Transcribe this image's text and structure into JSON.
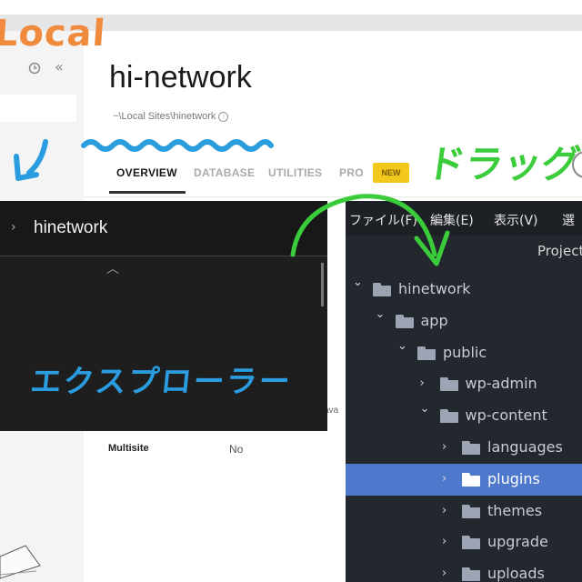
{
  "local_app": {
    "site_title": "hi-network",
    "site_path": "~\\Local Sites\\hinetwork",
    "tabs": [
      {
        "label": "OVERVIEW",
        "active": true
      },
      {
        "label": "DATABASE",
        "active": false
      },
      {
        "label": "UTILITIES",
        "active": false
      },
      {
        "label": "PRO",
        "active": false
      }
    ],
    "pro_badge": "NEW",
    "truncated_text": "ava",
    "multisite_label": "Multisite",
    "multisite_value": "No",
    "icons": [
      "clock-icon",
      "collapse-sidebar-icon",
      "info-icon"
    ]
  },
  "explorer": {
    "folder_title": "hinetwork",
    "icons": [
      "chevron-right-icon",
      "chevron-up-icon"
    ]
  },
  "editor": {
    "menu": [
      "ファイル(F)",
      "編集(E)",
      "表示(V)",
      "選"
    ],
    "project_title": "Project",
    "tree": [
      {
        "label": "hinetwork",
        "depth": 0,
        "expanded": true,
        "selected": false
      },
      {
        "label": "app",
        "depth": 1,
        "expanded": true,
        "selected": false
      },
      {
        "label": "public",
        "depth": 2,
        "expanded": true,
        "selected": false
      },
      {
        "label": "wp-admin",
        "depth": 3,
        "expanded": false,
        "selected": false
      },
      {
        "label": "wp-content",
        "depth": 3,
        "expanded": true,
        "selected": false
      },
      {
        "label": "languages",
        "depth": 4,
        "expanded": false,
        "selected": false
      },
      {
        "label": "plugins",
        "depth": 4,
        "expanded": false,
        "selected": true
      },
      {
        "label": "themes",
        "depth": 4,
        "expanded": false,
        "selected": false
      },
      {
        "label": "upgrade",
        "depth": 4,
        "expanded": false,
        "selected": false
      },
      {
        "label": "uploads",
        "depth": 4,
        "expanded": false,
        "selected": false
      }
    ]
  },
  "annotations": {
    "local": "Local",
    "explorer": "エクスプローラー",
    "drag": "ドラッグ"
  },
  "colors": {
    "local_orange": "#f08a3c",
    "marker_blue": "#2a9de0",
    "drag_green": "#3bcc3b",
    "badge_yellow": "#f2c81d",
    "selection_blue": "#4d78cc"
  }
}
